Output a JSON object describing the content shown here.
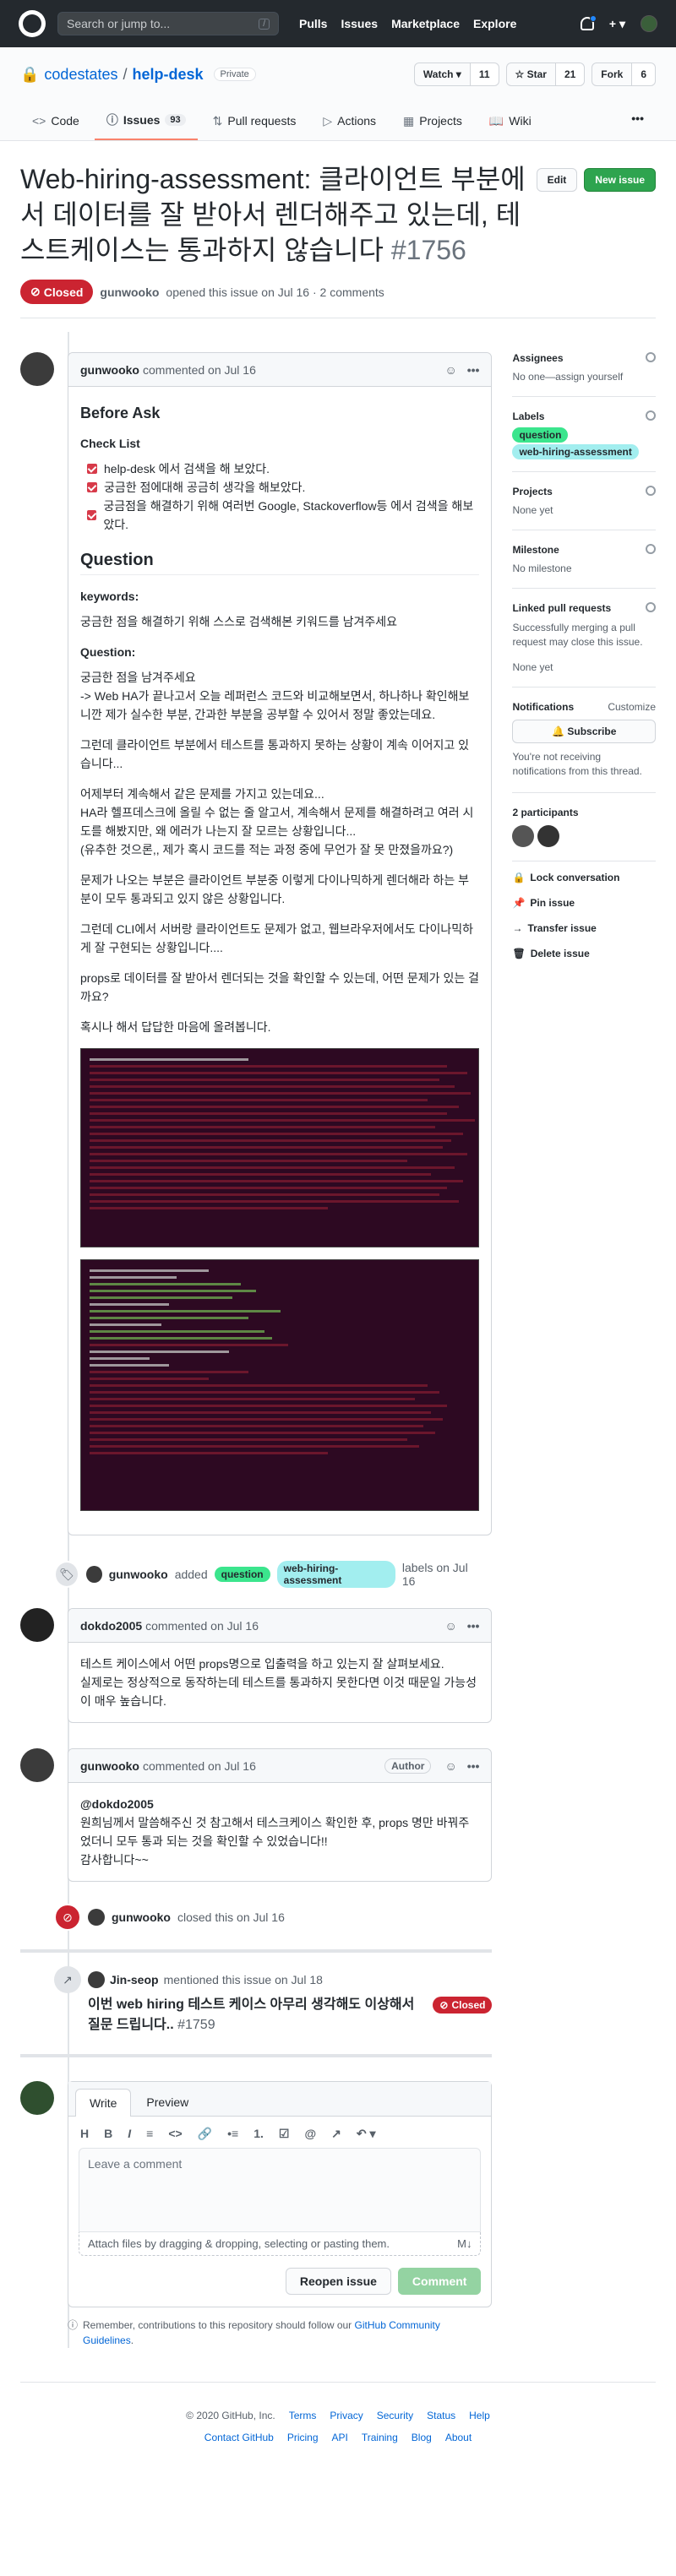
{
  "header": {
    "search_placeholder": "Search or jump to...",
    "slash": "/",
    "nav": [
      "Pulls",
      "Issues",
      "Marketplace",
      "Explore"
    ],
    "plus": "+ ▾"
  },
  "repo": {
    "owner": "codestates",
    "name": "help-desk",
    "visibility": "Private",
    "watch_label": "Watch ▾",
    "watch_count": "11",
    "star_label": "☆ Star",
    "star_count": "21",
    "fork_label": "Fork",
    "fork_count": "6",
    "tabs": [
      {
        "label": "Code"
      },
      {
        "label": "Issues",
        "count": "93"
      },
      {
        "label": "Pull requests"
      },
      {
        "label": "Actions"
      },
      {
        "label": "Projects"
      },
      {
        "label": "Wiki"
      }
    ],
    "more": "•••"
  },
  "issue": {
    "title": "Web-hiring-assessment: 클라이언트 부분에서 데이터를 잘 받아서 렌더해주고 있는데, 테스트케이스는 통과하지 않습니다",
    "number": "#1756",
    "edit_label": "Edit",
    "new_label": "New issue",
    "state": "Closed",
    "author": "gunwooko",
    "meta": "opened this issue on Jul 16 · 2 comments"
  },
  "first_comment": {
    "author": "gunwooko",
    "meta": "commented on Jul 16",
    "before_ask": "Before Ask",
    "check_list": "Check List",
    "checks": [
      "help-desk 에서 검색을 해 보았다.",
      "궁금한 점에대해 공금히 생각을 해보았다.",
      "궁금점을 해결하기 위해 여러번 Google, Stackoverflow등 에서 검색을 해보았다."
    ],
    "question_h": "Question",
    "keywords_h": "keywords:",
    "keywords": "궁금한 점을 해결하기 위해 스스로 검색해본 키워드를 남겨주세요",
    "question_label": "Question:",
    "p1": "궁금한 점을 남겨주세요",
    "p2": "-> Web HA가 끝나고서 오늘 레퍼런스 코드와 비교해보면서, 하나하나 확인해보니깐 제가 실수한 부분, 간과한 부분을 공부할 수 있어서 정말 좋았는데요.",
    "p3": "그런데 클라이언트 부분에서 테스트를 통과하지 못하는 상황이 계속 이어지고 있습니다...",
    "p4": "어제부터 계속해서 같은 문제를 가지고 있는데요...\nHA라 헬프데스크에 올릴 수 없는 줄 알고서, 계속해서 문제를 해결하려고 여러 시도를 해봤지만, 왜 에러가 나는지 잘 모르는 상황입니다...\n(유추한 것으론,, 제가 혹시 코드를 적는 과정 중에 무언가 잘 못 만졌을까요?)",
    "p5": "문제가 나오는 부분은 클라이언트 부분중 이렇게 다이나믹하게 렌더해라 하는 부분이 모두 통과되고 있지 않은 상황입니다.",
    "p6": "그런데 CLI에서 서버랑 클라이언트도 문제가 없고, 웹브라우저에서도 다이나믹하게 잘 구현되는 상황입니다....",
    "p7": "props로 데이터를 잘 받아서 렌더되는 것을 확인할 수 있는데, 어떤 문제가 있는 걸까요?",
    "p8": "혹시나 해서 답답한 마음에 올려봅니다."
  },
  "label_event": {
    "actor": "gunwooko",
    "added": "added",
    "labels": [
      "question",
      "web-hiring-assessment"
    ],
    "suffix": "labels on Jul 16"
  },
  "second_comment": {
    "author": "dokdo2005",
    "meta": "commented on Jul 16",
    "body1": "테스트 케이스에서 어떤 props명으로 입출력을 하고 있는지 잘 살펴보세요.",
    "body2": "실제로는 정상적으로 동작하는데 테스트를 통과하지 못한다면 이것 때문일 가능성이 매우 높습니다."
  },
  "third_comment": {
    "author": "gunwooko",
    "meta": "commented on Jul 16",
    "badge": "Author",
    "mention": "@dokdo2005",
    "body1": "원희님께서 말씀해주신 것 참고해서 테스크케이스 확인한 후, props 명만 바꿔주었더니 모두 통과 되는 것을 확인할 수 있었습니다!!",
    "body2": "감사합니다~~"
  },
  "close_event": {
    "actor": "gunwooko",
    "text": "closed this on Jul 16"
  },
  "mention_event": {
    "actor": "Jin-seop",
    "text": "mentioned this issue on Jul 18",
    "title": "이번 web hiring 테스트 케이스 아무리 생각해도 이상해서 질문 드립니다..",
    "number": "#1759",
    "state": "Closed"
  },
  "composer": {
    "tab_write": "Write",
    "tab_preview": "Preview",
    "tools": [
      "H",
      "B",
      "I",
      "≡",
      "<>",
      "🔗",
      "•≡",
      "1.",
      "☑",
      "@",
      "↗",
      "↶ ▾"
    ],
    "placeholder": "Leave a comment",
    "attach": "Attach files by dragging & dropping, selecting or pasting them.",
    "md": "M↓",
    "reopen": "Reopen issue",
    "comment": "Comment",
    "remember_pre": "Remember, contributions to this repository should follow our",
    "remember_link": "GitHub Community Guidelines",
    "remember_post": "."
  },
  "sidebar": {
    "assignees_h": "Assignees",
    "assignees": "No one—assign yourself",
    "labels_h": "Labels",
    "labels": [
      "question",
      "web-hiring-assessment"
    ],
    "projects_h": "Projects",
    "projects": "None yet",
    "milestone_h": "Milestone",
    "milestone": "No milestone",
    "linked_h": "Linked pull requests",
    "linked_desc": "Successfully merging a pull request may close this issue.",
    "linked": "None yet",
    "notif_h": "Notifications",
    "customize": "Customize",
    "subscribe": "🔔 Subscribe",
    "notif_desc": "You're not receiving notifications from this thread.",
    "participants": "2 participants",
    "actions": [
      "Lock conversation",
      "Pin issue",
      "Transfer issue",
      "Delete issue"
    ]
  },
  "footer": {
    "copyright": "© 2020 GitHub, Inc.",
    "row1": [
      "Terms",
      "Privacy",
      "Security",
      "Status",
      "Help"
    ],
    "row2": [
      "Contact GitHub",
      "Pricing",
      "API",
      "Training",
      "Blog",
      "About"
    ]
  }
}
